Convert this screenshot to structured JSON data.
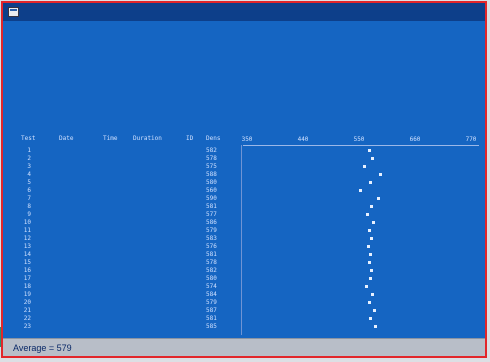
{
  "window": {
    "title": ""
  },
  "report": {
    "title_line1": "",
    "title_line2": "",
    "title_line3": "",
    "datetime": "",
    "fields_left": [
      "",
      "",
      "",
      "",
      ""
    ],
    "fields_right": [
      "",
      "",
      "",
      "",
      ""
    ],
    "columns": [
      "Test",
      "Date",
      "Time",
      "Duration",
      "ID",
      "Dens"
    ],
    "rows": [
      {
        "n": "1",
        "date": "",
        "time": "",
        "dur": "",
        "id": "",
        "val": "582",
        "dot": 579
      },
      {
        "n": "2",
        "date": "",
        "time": "",
        "dur": "",
        "id": "",
        "val": "578",
        "dot": 584
      },
      {
        "n": "3",
        "date": "",
        "time": "",
        "dur": "",
        "id": "",
        "val": "575",
        "dot": 570
      },
      {
        "n": "4",
        "date": "",
        "time": "",
        "dur": "",
        "id": "",
        "val": "588",
        "dot": 600
      },
      {
        "n": "5",
        "date": "",
        "time": "",
        "dur": "",
        "id": "",
        "val": "580",
        "dot": 580
      },
      {
        "n": "6",
        "date": "",
        "time": "",
        "dur": "",
        "id": "",
        "val": "560",
        "dot": 562
      },
      {
        "n": "7",
        "date": "",
        "time": "",
        "dur": "",
        "id": "",
        "val": "590",
        "dot": 595
      },
      {
        "n": "8",
        "date": "",
        "time": "",
        "dur": "",
        "id": "",
        "val": "581",
        "dot": 583
      },
      {
        "n": "9",
        "date": "",
        "time": "",
        "dur": "",
        "id": "",
        "val": "577",
        "dot": 575
      },
      {
        "n": "10",
        "date": "",
        "time": "",
        "dur": "",
        "id": "",
        "val": "586",
        "dot": 586
      },
      {
        "n": "11",
        "date": "",
        "time": "",
        "dur": "",
        "id": "",
        "val": "579",
        "dot": 579
      },
      {
        "n": "12",
        "date": "",
        "time": "",
        "dur": "",
        "id": "",
        "val": "583",
        "dot": 583
      },
      {
        "n": "13",
        "date": "",
        "time": "",
        "dur": "",
        "id": "",
        "val": "576",
        "dot": 576
      },
      {
        "n": "14",
        "date": "",
        "time": "",
        "dur": "",
        "id": "",
        "val": "581",
        "dot": 581
      },
      {
        "n": "15",
        "date": "",
        "time": "",
        "dur": "",
        "id": "",
        "val": "578",
        "dot": 578
      },
      {
        "n": "16",
        "date": "",
        "time": "",
        "dur": "",
        "id": "",
        "val": "582",
        "dot": 582
      },
      {
        "n": "17",
        "date": "",
        "time": "",
        "dur": "",
        "id": "",
        "val": "580",
        "dot": 580
      },
      {
        "n": "18",
        "date": "",
        "time": "",
        "dur": "",
        "id": "",
        "val": "574",
        "dot": 574
      },
      {
        "n": "19",
        "date": "",
        "time": "",
        "dur": "",
        "id": "",
        "val": "584",
        "dot": 584
      },
      {
        "n": "20",
        "date": "",
        "time": "",
        "dur": "",
        "id": "",
        "val": "579",
        "dot": 579
      },
      {
        "n": "21",
        "date": "",
        "time": "",
        "dur": "",
        "id": "",
        "val": "587",
        "dot": 588
      },
      {
        "n": "22",
        "date": "",
        "time": "",
        "dur": "",
        "id": "",
        "val": "581",
        "dot": 581
      },
      {
        "n": "23",
        "date": "",
        "time": "",
        "dur": "",
        "id": "",
        "val": "585",
        "dot": 590
      }
    ]
  },
  "axis": {
    "title": "",
    "ticks": [
      "350",
      "440",
      "550",
      "660",
      "770"
    ],
    "min": 350,
    "max": 770
  },
  "status": {
    "average_label": "Average",
    "average_sep": " = ",
    "average_value": "579"
  },
  "colors": {
    "screen": "#1565c2",
    "text": "#cfe0ff",
    "frame": "#e2262a",
    "statusbar": "#b8bec8"
  }
}
